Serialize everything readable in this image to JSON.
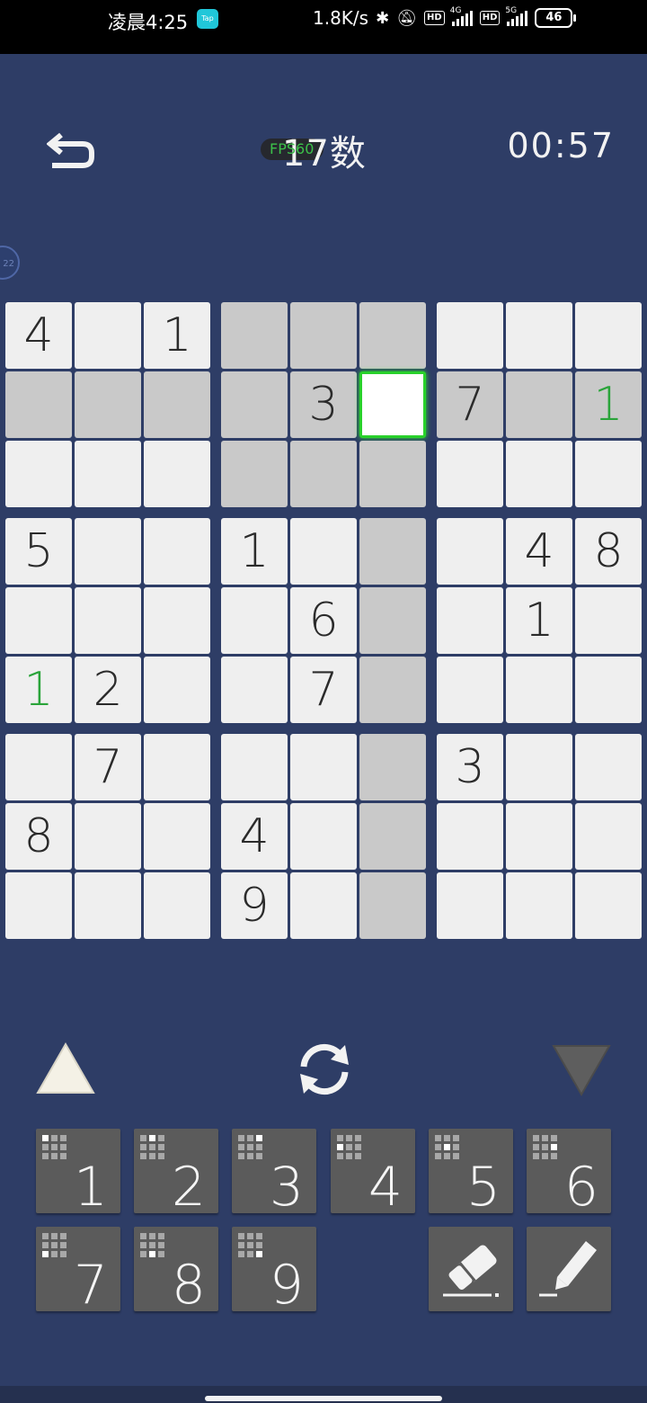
{
  "status_bar": {
    "time": "凌晨4:25",
    "tap_badge": "Tap",
    "net_speed": "1.8K/s",
    "hd1": "HD",
    "net1": "4G",
    "hd2": "HD",
    "net2": "5G",
    "battery": "46"
  },
  "header": {
    "back_icon": "undo-arrow-icon",
    "fps": "FPS60",
    "title": "17数",
    "timer": "00:57"
  },
  "side_bubble": "22",
  "board": {
    "rows": [
      [
        "4",
        "",
        "1",
        "",
        "",
        "",
        "",
        "",
        ""
      ],
      [
        "",
        "",
        "",
        "",
        "3",
        "",
        "7",
        "",
        "1"
      ],
      [
        "",
        "",
        "",
        "",
        "",
        "",
        "",
        "",
        ""
      ],
      [
        "5",
        "",
        "",
        "1",
        "",
        "",
        "",
        "4",
        "8"
      ],
      [
        "",
        "",
        "",
        "",
        "6",
        "",
        "",
        "1",
        ""
      ],
      [
        "1",
        "2",
        "",
        "",
        "7",
        "",
        "",
        "",
        ""
      ],
      [
        "",
        "7",
        "",
        "",
        "",
        "",
        "3",
        "",
        ""
      ],
      [
        "8",
        "",
        "",
        "4",
        "",
        "",
        "",
        "",
        ""
      ],
      [
        "",
        "",
        "",
        "9",
        "",
        "",
        "",
        "",
        ""
      ]
    ],
    "selected": [
      1,
      5
    ],
    "user_entered": [
      [
        1,
        8
      ],
      [
        5,
        0
      ]
    ],
    "highlight_color": "#c9c9c9",
    "cell_color": "#efefef",
    "selected_border": "#29d12b",
    "user_digit_color": "#2aa43a"
  },
  "controls": {
    "up_icon": "triangle-up-icon",
    "refresh_icon": "refresh-icon",
    "down_icon": "triangle-down-icon"
  },
  "keypad": {
    "digits": [
      "1",
      "2",
      "3",
      "4",
      "5",
      "6",
      "7",
      "8",
      "9"
    ],
    "eraser_icon": "eraser-icon",
    "pencil_icon": "pencil-icon"
  }
}
